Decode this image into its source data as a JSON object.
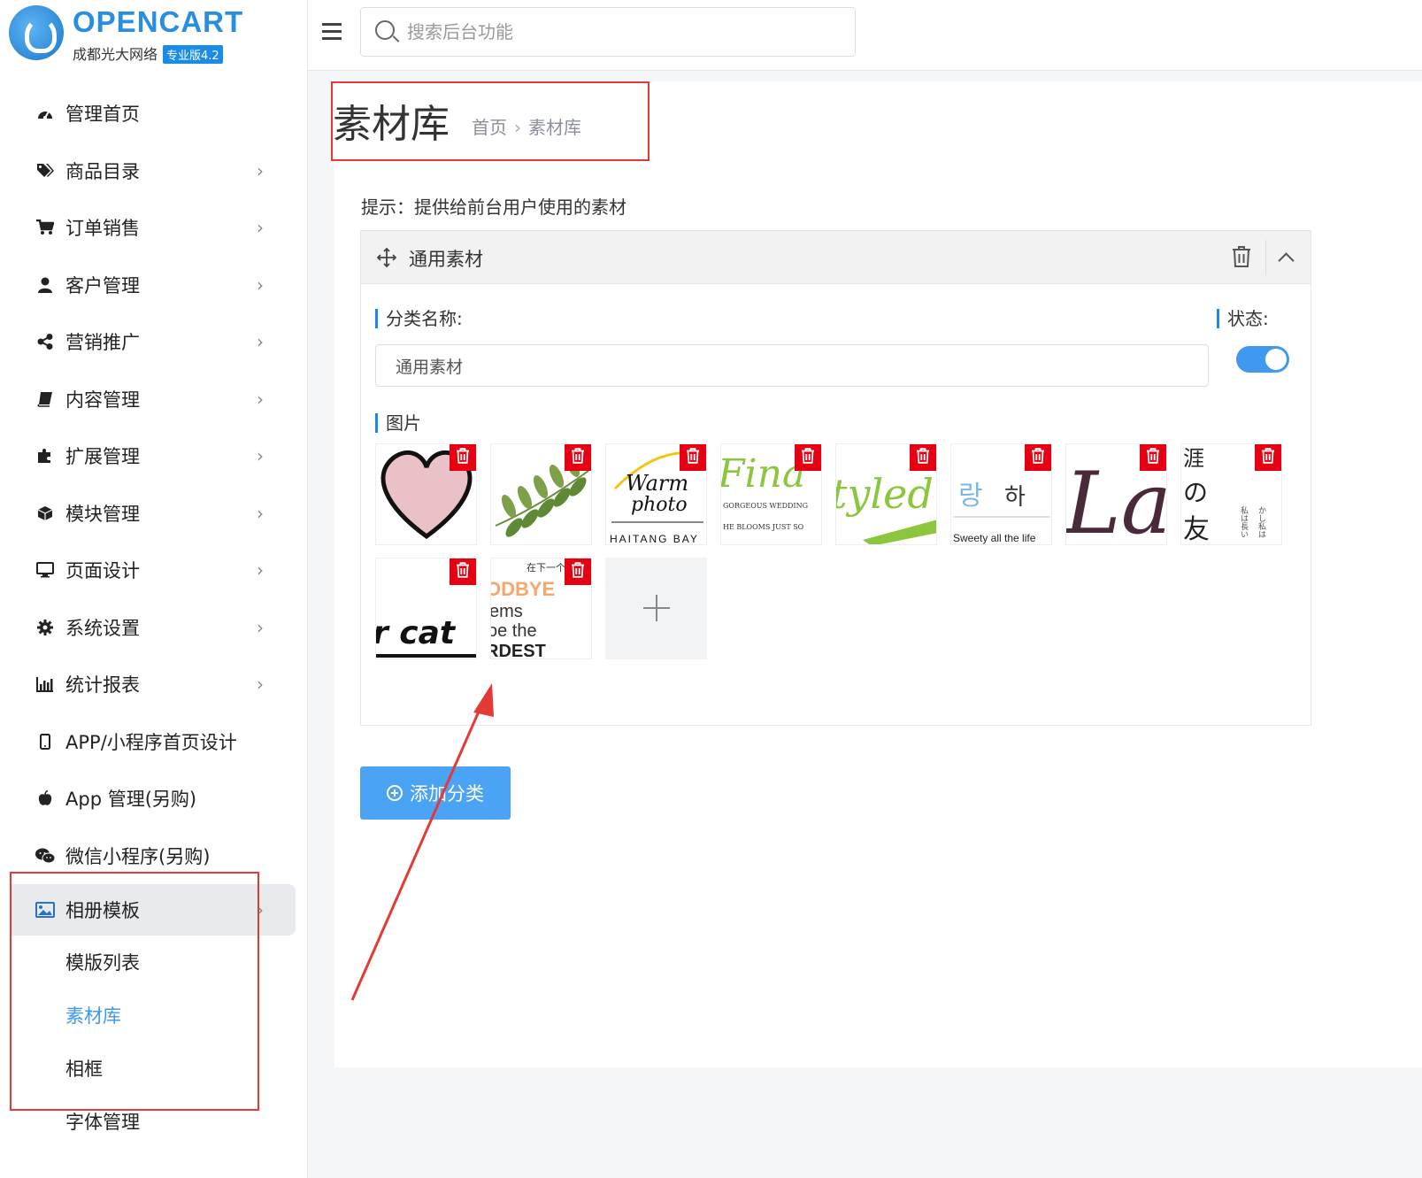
{
  "brand": {
    "title": "OPENCART",
    "subtitle": "成都光大网络",
    "badge": "专业版4.2"
  },
  "search": {
    "placeholder": "搜索后台功能"
  },
  "sidebar": {
    "items": [
      {
        "label": "管理首页",
        "icon": "dashboard-icon"
      },
      {
        "label": "商品目录",
        "icon": "tags-icon"
      },
      {
        "label": "订单销售",
        "icon": "cart-icon"
      },
      {
        "label": "客户管理",
        "icon": "user-icon"
      },
      {
        "label": "营销推广",
        "icon": "share-icon"
      },
      {
        "label": "内容管理",
        "icon": "book-icon"
      },
      {
        "label": "扩展管理",
        "icon": "puzzle-icon"
      },
      {
        "label": "模块管理",
        "icon": "cube-icon"
      },
      {
        "label": "页面设计",
        "icon": "desktop-icon"
      },
      {
        "label": "系统设置",
        "icon": "gear-icon"
      },
      {
        "label": "统计报表",
        "icon": "bar-chart-icon"
      },
      {
        "label": "APP/小程序首页设计",
        "icon": "mobile-icon"
      },
      {
        "label": "App 管理(另购)",
        "icon": "apple-icon"
      },
      {
        "label": "微信小程序(另购)",
        "icon": "wechat-icon"
      },
      {
        "label": "相册模板",
        "icon": "image-icon"
      }
    ],
    "submenu": [
      {
        "label": "模版列表"
      },
      {
        "label": "素材库"
      },
      {
        "label": "相框"
      },
      {
        "label": "字体管理"
      }
    ]
  },
  "page": {
    "title": "素材库",
    "breadcrumb": [
      "首页",
      "素材库"
    ],
    "breadcrumb_sep": "›",
    "tip": "提示：提供给前台用户使用的素材"
  },
  "category": {
    "header_title": "通用素材",
    "name_label": "分类名称:",
    "name_value": "通用素材",
    "status_label": "状态:",
    "status_on": true,
    "images_label": "图片",
    "images": [
      {
        "name": "heart"
      },
      {
        "name": "leaves"
      },
      {
        "name": "warm-photo",
        "text": "Warm photo",
        "caption": "HAITANG BAY"
      },
      {
        "name": "final-script",
        "caption": "GORGEOUS WEDDING"
      },
      {
        "name": "styled-script"
      },
      {
        "name": "korean-text",
        "caption": "Sweety all the life"
      },
      {
        "name": "la-script"
      },
      {
        "name": "japanese-text"
      },
      {
        "name": "cat-text",
        "text": "r cat"
      },
      {
        "name": "goodbye-text",
        "text": "ODBYE"
      }
    ]
  },
  "buttons": {
    "add_category": "添加分类"
  },
  "colors": {
    "accent": "#4098f0",
    "danger": "#e60012",
    "annotation": "#e53935"
  }
}
